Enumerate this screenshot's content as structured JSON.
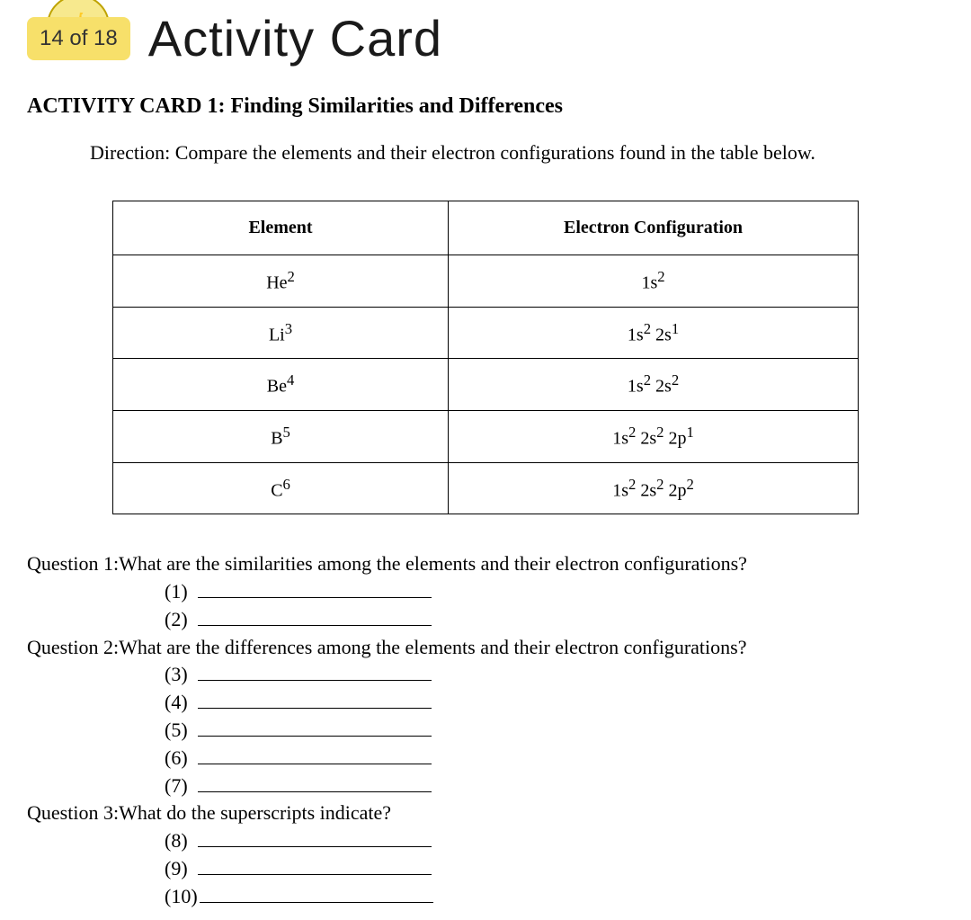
{
  "header": {
    "page_counter": "14 of 18",
    "title": "Activity Card"
  },
  "card": {
    "heading": "ACTIVITY CARD 1: Finding Similarities and Differences",
    "direction": "Direction: Compare the elements and their electron configurations found in the table below."
  },
  "table": {
    "headers": {
      "element": "Element",
      "config": "Electron Configuration"
    },
    "rows": [
      {
        "elem": "He",
        "elem_sup": "2",
        "config": "1s",
        "config_parts": [
          {
            "t": "1s",
            "s": "2"
          }
        ]
      },
      {
        "elem": "Li",
        "elem_sup": "3",
        "config_parts": [
          {
            "t": "1s",
            "s": "2"
          },
          {
            "t": " 2s",
            "s": "1"
          }
        ]
      },
      {
        "elem": "Be",
        "elem_sup": "4",
        "config_parts": [
          {
            "t": "1s",
            "s": "2"
          },
          {
            "t": " 2s",
            "s": "2"
          }
        ]
      },
      {
        "elem": "B",
        "elem_sup": "5",
        "config_parts": [
          {
            "t": "1s",
            "s": "2"
          },
          {
            "t": " 2s",
            "s": "2"
          },
          {
            "t": " 2p",
            "s": "1"
          }
        ]
      },
      {
        "elem": "C",
        "elem_sup": "6",
        "config_parts": [
          {
            "t": "1s",
            "s": "2"
          },
          {
            "t": " 2s",
            "s": "2"
          },
          {
            "t": " 2p",
            "s": "2"
          }
        ]
      }
    ]
  },
  "questions": {
    "q1": {
      "label": "Question 1: ",
      "text": "What are the similarities among the elements and their electron configurations?",
      "blanks": [
        "(1)",
        "(2)"
      ]
    },
    "q2": {
      "label": "Question 2: ",
      "text": "What are the differences among the elements and  their electron configurations?",
      "blanks": [
        "(3)",
        "(4)",
        "(5)",
        "(6)",
        "(7)"
      ]
    },
    "q3": {
      "label": "Question 3: ",
      "text": "What do the superscripts indicate?",
      "blanks": [
        "(8)",
        "(9)",
        "(10)"
      ]
    }
  }
}
